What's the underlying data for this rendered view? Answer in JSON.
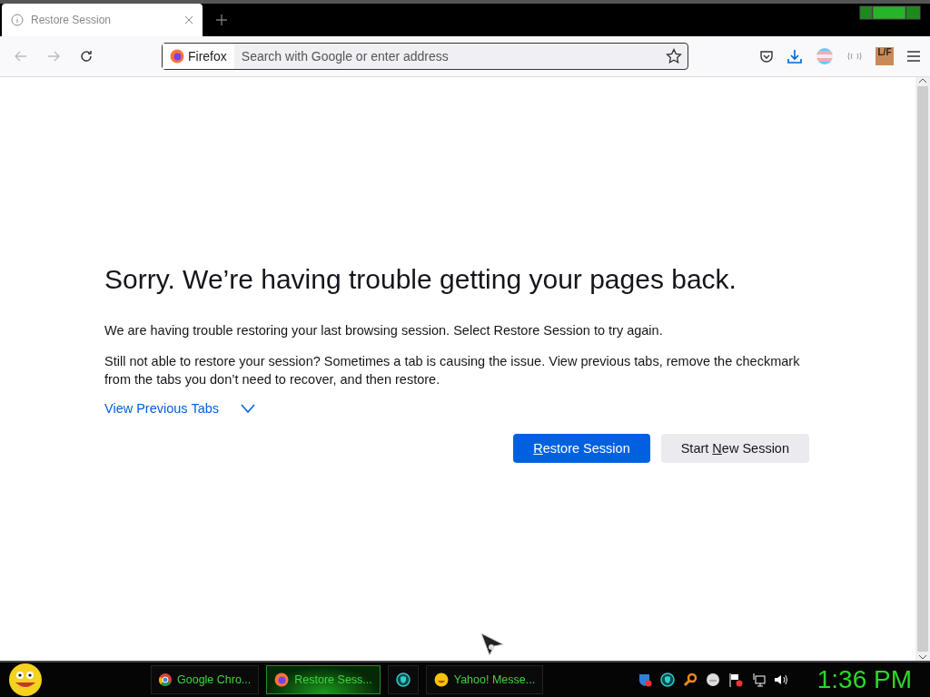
{
  "tab": {
    "title": "Restore Session",
    "selected": true
  },
  "toolbar": {
    "identity": "Firefox",
    "address_placeholder": "Search with Google or enter address",
    "extension_badge": "L/F"
  },
  "page": {
    "heading": "Sorry. We’re having trouble getting your pages back.",
    "paragraphs": [
      "We are having trouble restoring your last browsing session. Select Restore Session to try again.",
      "Still not able to restore your session? Sometimes a tab is causing the issue. View previous tabs, remove the checkmark from the tabs you don’t need to recover, and then restore."
    ],
    "toggle": {
      "label": "View Previous Tabs",
      "expanded": false
    },
    "buttons": [
      {
        "kind": "primary",
        "access_key": "R",
        "after": "estore Session"
      },
      {
        "kind": "secondary",
        "before": "Start ",
        "access_key": "N",
        "after": "ew Session"
      }
    ]
  },
  "taskbar": {
    "tasks": [
      {
        "kind": "chrome",
        "label": "Google Chro...",
        "selected": false
      },
      {
        "kind": "firefox",
        "label": "Restore Sess...",
        "selected": true
      },
      {
        "kind": "shield",
        "selected": false
      },
      {
        "kind": "yahoo",
        "label": "Yahoo! Messe...",
        "selected": false
      }
    ],
    "clock": "1:36 PM"
  }
}
